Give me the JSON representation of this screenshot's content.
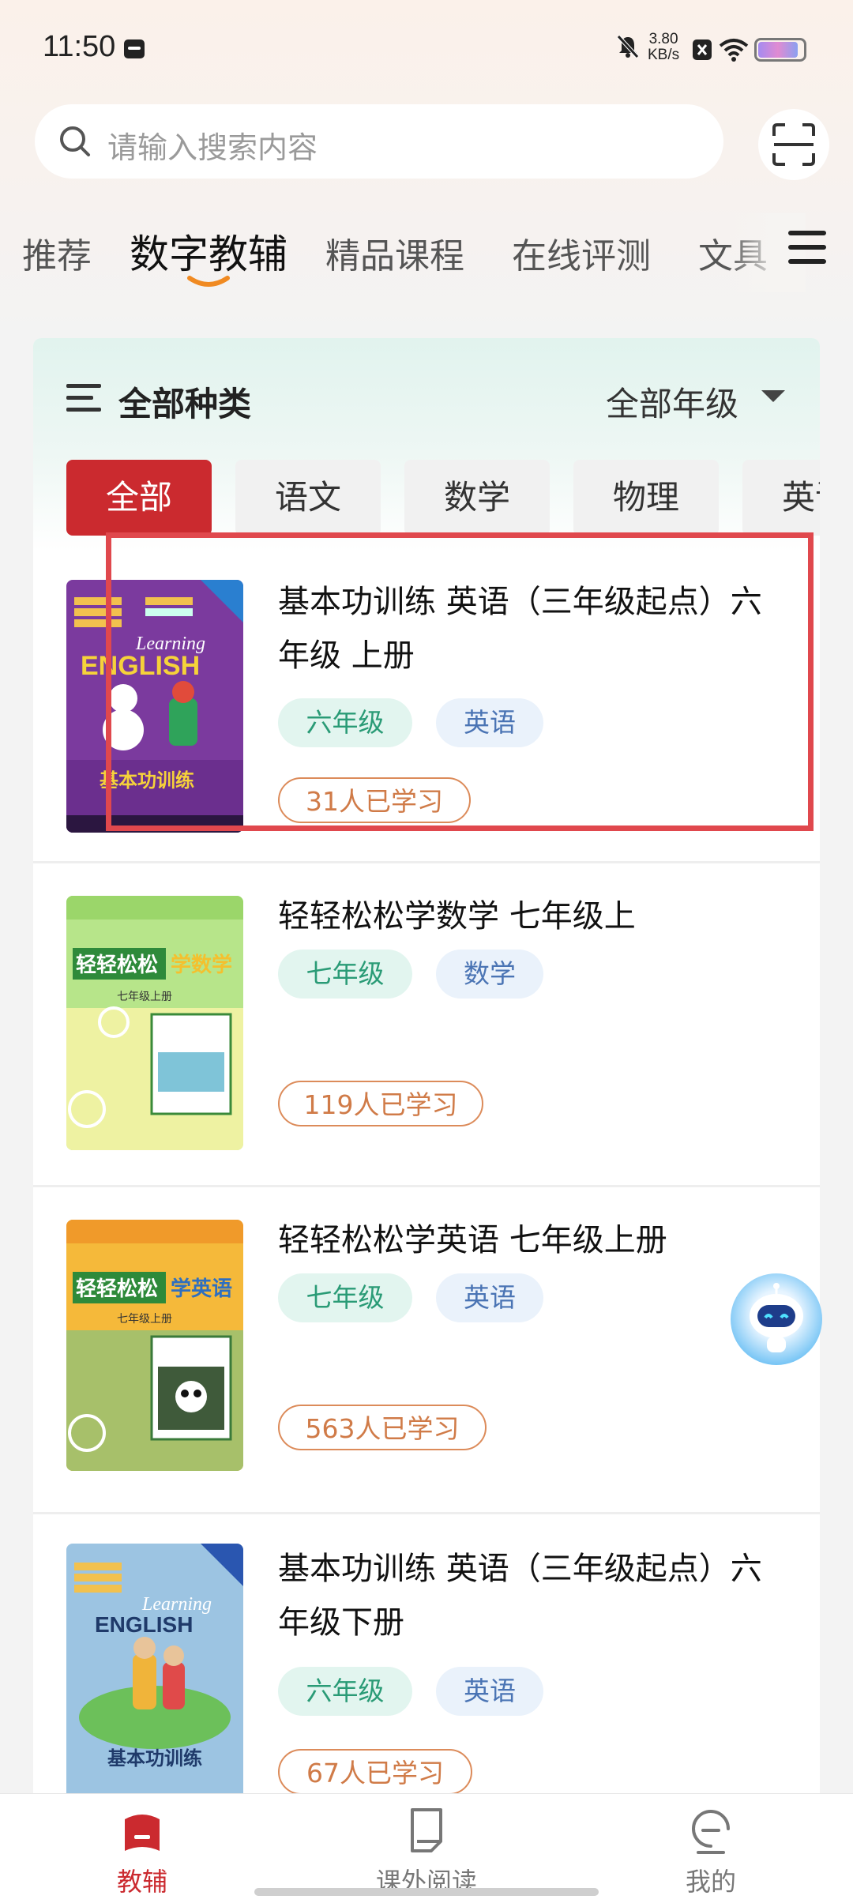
{
  "status": {
    "time": "11:50",
    "net_speed_value": "3.80",
    "net_speed_unit": "KB/s",
    "battery_percent": 90
  },
  "search": {
    "placeholder": "请输入搜索内容"
  },
  "top_tabs": [
    {
      "label": "推荐",
      "active": false
    },
    {
      "label": "数字教辅",
      "active": true
    },
    {
      "label": "精品课程",
      "active": false
    },
    {
      "label": "在线评测",
      "active": false
    },
    {
      "label": "文具",
      "active": false
    }
  ],
  "filters": {
    "all_kinds": "全部种类",
    "all_grades": "全部年级"
  },
  "subject_chips": [
    {
      "label": "全部",
      "active": true
    },
    {
      "label": "语文",
      "active": false
    },
    {
      "label": "数学",
      "active": false
    },
    {
      "label": "物理",
      "active": false
    },
    {
      "label": "英语",
      "active": false
    }
  ],
  "books": [
    {
      "title": "基本功训练 英语（三年级起点）六年级 上册",
      "grade": "六年级",
      "subject": "英语",
      "learned": "31人已学习"
    },
    {
      "title": "轻轻松松学数学 七年级上",
      "grade": "七年级",
      "subject": "数学",
      "learned": "119人已学习"
    },
    {
      "title": "轻轻松松学英语 七年级上册",
      "grade": "七年级",
      "subject": "英语",
      "learned": "563人已学习"
    },
    {
      "title": "基本功训练 英语（三年级起点）六年级下册",
      "grade": "六年级",
      "subject": "英语",
      "learned": "67人已学习"
    }
  ],
  "covers": [
    {
      "top_text": "Learning",
      "main_text": "ENGLISH",
      "bottom_text": "基本功训练",
      "bg": "#7a3aa0",
      "icon": "book-cover-english-purple"
    },
    {
      "top_text": "轻轻松松",
      "main_text": "学数学",
      "bottom_text": "七年级上册",
      "bg": "#a8e07a",
      "icon": "book-cover-math-green"
    },
    {
      "top_text": "轻轻松松",
      "main_text": "学英语",
      "bottom_text": "七年级上册",
      "bg": "#f4b63a",
      "icon": "book-cover-english-yellow"
    },
    {
      "top_text": "Learning",
      "main_text": "ENGLISH",
      "bottom_text": "基本功训练",
      "bg": "#8fb8d8",
      "icon": "book-cover-english-blue"
    }
  ],
  "bottom_nav": [
    {
      "label": "教辅",
      "active": true,
      "icon": "book-icon"
    },
    {
      "label": "课外阅读",
      "active": false,
      "icon": "reading-icon"
    },
    {
      "label": "我的",
      "active": false,
      "icon": "profile-icon"
    }
  ],
  "colors": {
    "brand_red": "#cb2a2f",
    "highlight_red": "#e0484d",
    "grade_tag": "#2a9b76",
    "subject_tag": "#4a74b4",
    "learned_orange": "#d07b48"
  }
}
